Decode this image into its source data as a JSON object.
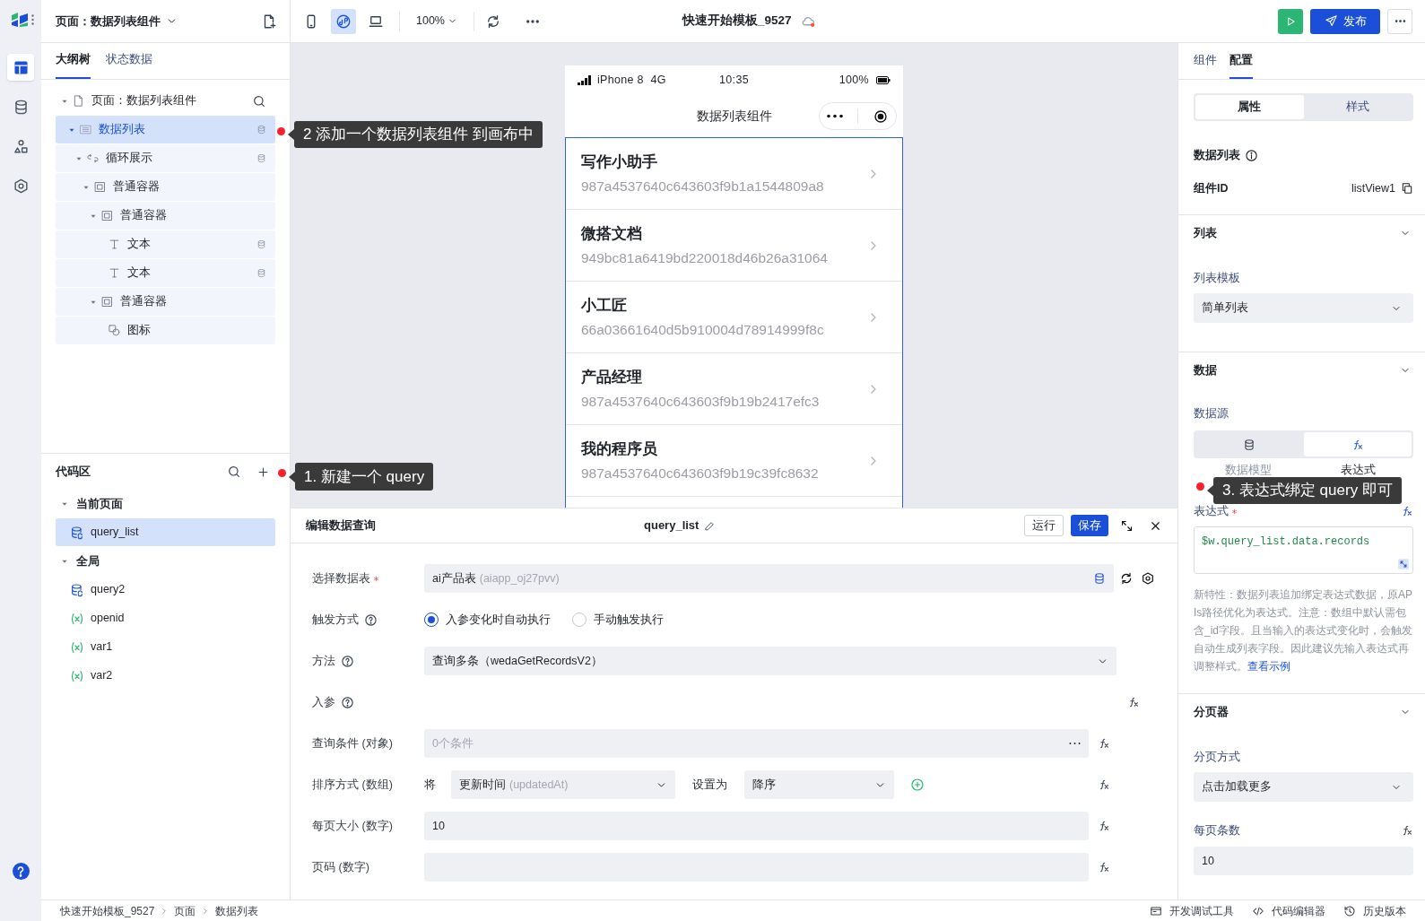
{
  "rail": {
    "items": [
      {
        "kind": "outline",
        "selected": true
      },
      {
        "kind": "data",
        "selected": false
      },
      {
        "kind": "components",
        "selected": false
      },
      {
        "kind": "settings",
        "selected": false
      }
    ]
  },
  "page_selector": "页面：数据列表组件",
  "left_tabs": [
    {
      "label": "大纲树",
      "selected": true
    },
    {
      "label": "状态数据",
      "selected": false
    }
  ],
  "outline": {
    "annotation": "2 添加一个数据列表组件 到画布中",
    "tree": [
      {
        "label": "页面：数据列表组件",
        "kind": "page",
        "selected": false,
        "bound": false,
        "children": [
          {
            "label": "数据列表",
            "kind": "list",
            "selected": true,
            "bound": true,
            "children": [
              {
                "label": "循环展示",
                "kind": "loop",
                "selected": false,
                "bound": true,
                "children": [
                  {
                    "label": "普通容器",
                    "kind": "container",
                    "selected": false,
                    "bound": false,
                    "children": [
                      {
                        "label": "普通容器",
                        "kind": "container",
                        "selected": false,
                        "bound": false,
                        "children": [
                          {
                            "label": "文本",
                            "kind": "text",
                            "selected": false,
                            "bound": true
                          },
                          {
                            "label": "文本",
                            "kind": "text",
                            "selected": false,
                            "bound": true
                          }
                        ]
                      },
                      {
                        "label": "普通容器",
                        "kind": "container",
                        "selected": false,
                        "bound": false,
                        "children": [
                          {
                            "label": "图标",
                            "kind": "icon",
                            "selected": false,
                            "bound": false
                          }
                        ]
                      }
                    ]
                  }
                ]
              }
            ]
          }
        ]
      }
    ]
  },
  "code_area": {
    "title": "代码区",
    "annotation": "1. 新建一个 query",
    "groups": [
      {
        "label": "当前页面",
        "items": [
          {
            "label": "query_list",
            "kind": "query",
            "selected": true
          }
        ]
      },
      {
        "label": "全局",
        "items": [
          {
            "label": "query2",
            "kind": "query",
            "selected": false
          },
          {
            "label": "openid",
            "kind": "variable",
            "selected": false
          },
          {
            "label": "var1",
            "kind": "variable",
            "selected": false
          },
          {
            "label": "var2",
            "kind": "variable",
            "selected": false
          }
        ]
      }
    ]
  },
  "toolbar": {
    "devices": [
      {
        "kind": "mobile",
        "selected": false
      },
      {
        "kind": "miniprogram",
        "selected": true
      },
      {
        "kind": "desktop",
        "selected": false
      }
    ],
    "zoom": "100%",
    "app_title": "快速开始模板_9527",
    "publish": "发布"
  },
  "phone": {
    "carrier": "iPhone 8  4G",
    "time": "10:35",
    "battery": "100%",
    "title": "数据列表组件",
    "items": [
      {
        "title": "写作小助手",
        "subtitle": "987a4537640c643603f9b1a1544809a8"
      },
      {
        "title": "微搭文档",
        "subtitle": "949bc81a6419bd220018d46b26a31064"
      },
      {
        "title": "小工匠",
        "subtitle": "66a03661640d5b910004d78914999f8c"
      },
      {
        "title": "产品经理",
        "subtitle": "987a4537640c643603f9b19b2417efc3"
      },
      {
        "title": "我的程序员",
        "subtitle": "987a4537640c643603f9b19c39fc8632"
      }
    ]
  },
  "query_editor": {
    "heading": "编辑数据查询",
    "name": "query_list",
    "run": "运行",
    "save": "保存",
    "fields": [
      {
        "kind": "table",
        "label": "选择数据表",
        "required": true,
        "value": "ai产品表",
        "hint": "(aiapp_oj27pvv)"
      },
      {
        "kind": "radio",
        "label": "触发方式",
        "help": true,
        "options": [
          {
            "label": "入参变化时自动执行",
            "selected": true
          },
          {
            "label": "手动触发执行",
            "selected": false
          }
        ]
      },
      {
        "kind": "select",
        "label": "方法",
        "help": true,
        "value": "查询多条（wedaGetRecordsV2）"
      },
      {
        "kind": "heading",
        "label": "入参",
        "help": true
      },
      {
        "kind": "conditions",
        "label": "查询条件 (对象)",
        "placeholder": "0个条件"
      },
      {
        "kind": "sort",
        "label": "排序方式 (数组)",
        "prefix": "将",
        "field": "更新时间",
        "field_hint": "(updatedAt)",
        "set_to": "设置为",
        "order": "降序"
      },
      {
        "kind": "input",
        "label": "每页大小 (数字)",
        "value": "10"
      },
      {
        "kind": "input",
        "label": "页码 (数字)"
      }
    ]
  },
  "config": {
    "tabs": [
      {
        "label": "组件",
        "selected": false
      },
      {
        "label": "配置",
        "selected": true
      }
    ],
    "segments": [
      {
        "label": "属性",
        "selected": true
      },
      {
        "label": "样式",
        "selected": false
      }
    ],
    "component_title": "数据列表",
    "id_label": "组件ID",
    "id_value": "listView1",
    "sections": [
      {
        "title": "列表",
        "expanded": true,
        "rows": [
          {
            "kind": "select",
            "label": "列表模板",
            "value": "简单列表"
          }
        ]
      },
      {
        "title": "数据",
        "expanded": true,
        "annotation": "3. 表达式绑定 query 即可",
        "rows": [
          {
            "kind": "source",
            "label": "数据源",
            "options": [
              {
                "kind": "model",
                "label": "数据模型",
                "selected": false
              },
              {
                "kind": "expression",
                "label": "表达式",
                "selected": true
              }
            ]
          },
          {
            "kind": "expression",
            "label": "表达式",
            "required": true,
            "value": "$w.query_list.data.records",
            "help": "新特性：数据列表追加绑定表达式数据，原APIs路径优化为表达式。注意：数组中默认需包含_id字段。且当输入的表达式变化时，会触发自动生成列表字段。因此建议先输入表达式再调整样式。",
            "link": "查看示例"
          }
        ]
      },
      {
        "title": "分页器",
        "expanded": true,
        "rows": [
          {
            "kind": "select",
            "label": "分页方式",
            "value": "点击加载更多"
          },
          {
            "kind": "input",
            "label": "每页条数",
            "value": "10"
          }
        ]
      }
    ]
  },
  "status_bar": {
    "breadcrumbs": [
      "快速开始模板_9527",
      "页面",
      "数据列表"
    ],
    "tools": [
      {
        "kind": "console",
        "label": "开发调试工具"
      },
      {
        "kind": "code",
        "label": "代码编辑器"
      },
      {
        "kind": "history",
        "label": "历史版本"
      }
    ]
  }
}
